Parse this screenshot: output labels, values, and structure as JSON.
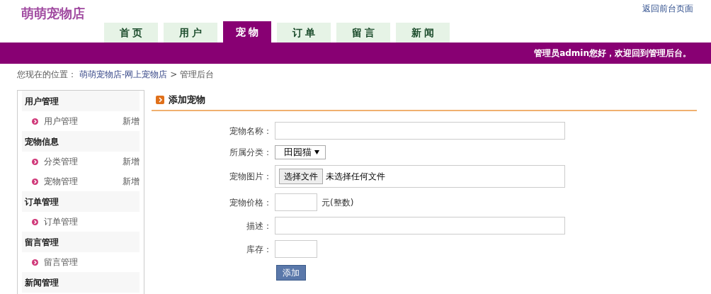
{
  "logo": "萌萌宠物店",
  "top_link": "返回前台页面",
  "tabs": [
    {
      "label": "首 页",
      "selected": false
    },
    {
      "label": "用 户",
      "selected": false
    },
    {
      "label": "宠 物",
      "selected": true
    },
    {
      "label": "订 单",
      "selected": false
    },
    {
      "label": "留 言",
      "selected": false
    },
    {
      "label": "新 闻",
      "selected": false
    }
  ],
  "welcome": "管理员admin您好，欢迎回到管理后台。",
  "breadcrumb": {
    "prefix": "您现在的位置：",
    "link": "萌萌宠物店-网上宠物店",
    "separator": ">",
    "current": "管理后台"
  },
  "sidebar": [
    {
      "title": "用户管理",
      "items": [
        {
          "label": "用户管理",
          "action": "新增"
        }
      ]
    },
    {
      "title": "宠物信息",
      "items": [
        {
          "label": "分类管理",
          "action": "新增"
        },
        {
          "label": "宠物管理",
          "action": "新增"
        }
      ]
    },
    {
      "title": "订单管理",
      "items": [
        {
          "label": "订单管理"
        }
      ]
    },
    {
      "title": "留言管理",
      "items": [
        {
          "label": "留言管理"
        }
      ]
    },
    {
      "title": "新闻管理"
    }
  ],
  "panel_title": "添加宠物",
  "form": [
    {
      "kind": "text",
      "label": "宠物名称："
    },
    {
      "kind": "select",
      "label": "所属分类：",
      "value": "田园猫"
    },
    {
      "kind": "file",
      "label": "宠物图片：",
      "button": "选择文件",
      "status": "未选择任何文件"
    },
    {
      "kind": "short",
      "label": "宠物价格：",
      "suffix": "元(整数)"
    },
    {
      "kind": "text",
      "label": "描述："
    },
    {
      "kind": "short",
      "label": "库存："
    }
  ],
  "submit": "添加"
}
